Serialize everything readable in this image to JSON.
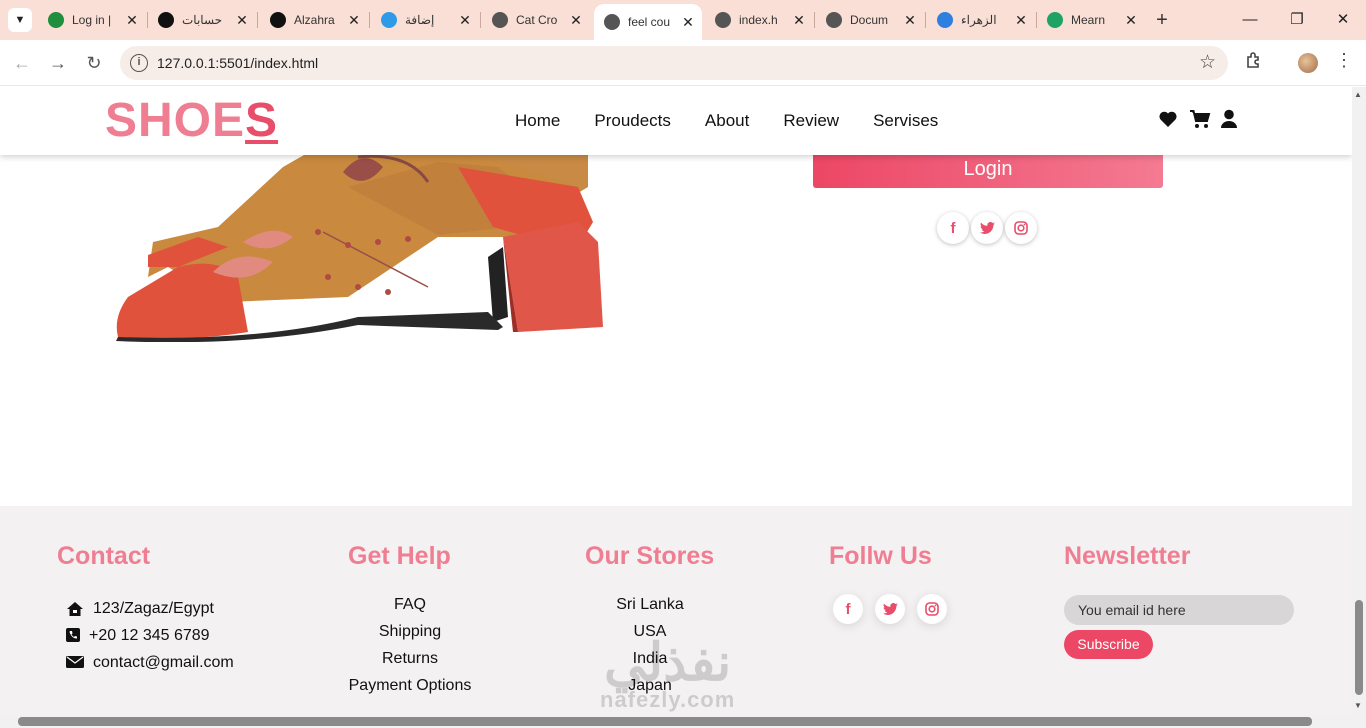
{
  "browser": {
    "tabs": [
      {
        "title": "Log in |",
        "favicon": "mongodb-leaf-icon",
        "fav_color": "#1f8f3f"
      },
      {
        "title": "حسابات",
        "favicon": "threads-icon",
        "fav_color": "#111111"
      },
      {
        "title": "Alzahra",
        "favicon": "upwork-icon",
        "fav_color": "#111111"
      },
      {
        "title": "إضافة",
        "favicon": "blue-circle-icon",
        "fav_color": "#2f9be8"
      },
      {
        "title": "Cat Cro",
        "favicon": "globe-icon",
        "fav_color": "#555555"
      },
      {
        "title": "feel cou",
        "favicon": "globe-icon",
        "fav_color": "#555555",
        "active": true
      },
      {
        "title": "index.h",
        "favicon": "globe-icon",
        "fav_color": "#555555"
      },
      {
        "title": "Docum",
        "favicon": "globe-icon",
        "fav_color": "#555555"
      },
      {
        "title": "الزهراء",
        "favicon": "blue-swirl-icon",
        "fav_color": "#2f7fe0"
      },
      {
        "title": "Mearn",
        "favicon": "green-plus-icon",
        "fav_color": "#1ea362"
      }
    ],
    "url": "127.0.0.1:5501/index.html"
  },
  "site": {
    "logo_main": "SHOE",
    "logo_last": "S",
    "nav": [
      "Home",
      "Proudects",
      "About",
      "Review",
      "Servises"
    ],
    "header_icons": [
      "heart-icon",
      "cart-icon",
      "user-icon"
    ],
    "login_label": "Login",
    "social": [
      "facebook-icon",
      "twitter-icon",
      "instagram-icon"
    ]
  },
  "footer": {
    "contact": {
      "heading": "Contact",
      "items": [
        {
          "icon": "home-icon",
          "text": "123/Zagaz/Egypt"
        },
        {
          "icon": "phone-square-icon",
          "text": "+20 12 345 6789"
        },
        {
          "icon": "envelope-icon",
          "text": "contact@gmail.com"
        }
      ]
    },
    "help": {
      "heading": "Get Help",
      "items": [
        "FAQ",
        "Shipping",
        "Returns",
        "Payment Options"
      ]
    },
    "stores": {
      "heading": "Our Stores",
      "items": [
        "Sri Lanka",
        "USA",
        "India",
        "Japan"
      ]
    },
    "follow": {
      "heading": "Follw Us"
    },
    "newsletter": {
      "heading": "Newsletter",
      "placeholder": "You email id here",
      "button": "Subscribe"
    }
  },
  "watermark": {
    "arabic": "نفذلي",
    "latin": "nafezly.com"
  },
  "colors": {
    "brand_pink": "#f07e92",
    "accent": "#e84d6a"
  }
}
